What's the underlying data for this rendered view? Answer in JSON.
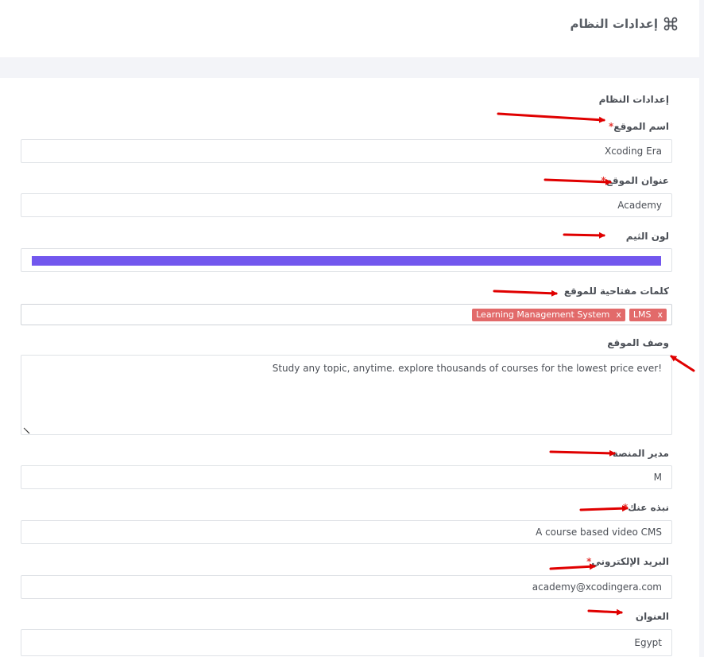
{
  "header": {
    "title": "إعدادات النظام",
    "icon": "command-icon"
  },
  "section": {
    "title": "إعدادات النظام"
  },
  "fields": {
    "site_name": {
      "label": "اسم الموقع",
      "required": "*",
      "value": "Xcoding Era"
    },
    "site_title": {
      "label": "عنوان الموقع",
      "required": "*",
      "value": "Academy"
    },
    "theme_color": {
      "label": "لون الثيم",
      "color": "#7257ee"
    },
    "keywords": {
      "label": "كلمات مفتاحية للموقع",
      "tags": [
        {
          "text": "Learning Management System",
          "remove": "x"
        },
        {
          "text": "LMS",
          "remove": "x"
        }
      ]
    },
    "description": {
      "label": "وصف الموقع",
      "value": "Study any topic, anytime. explore thousands of courses for the lowest price ever!"
    },
    "platform_manager": {
      "label": "مدير المنصة",
      "value": "M"
    },
    "about": {
      "label": "نبذه عنك",
      "required": "*",
      "value": "A course based video CMS"
    },
    "email": {
      "label": "البريد الإلكتروني",
      "required": "*",
      "value": "academy@xcodingera.com"
    },
    "address": {
      "label": "العنوان",
      "value": "Egypt"
    }
  },
  "colors": {
    "accent": "#7257ee",
    "tag": "#e26a6a",
    "required": "#e53935",
    "annotation_arrow": "#e00000"
  }
}
